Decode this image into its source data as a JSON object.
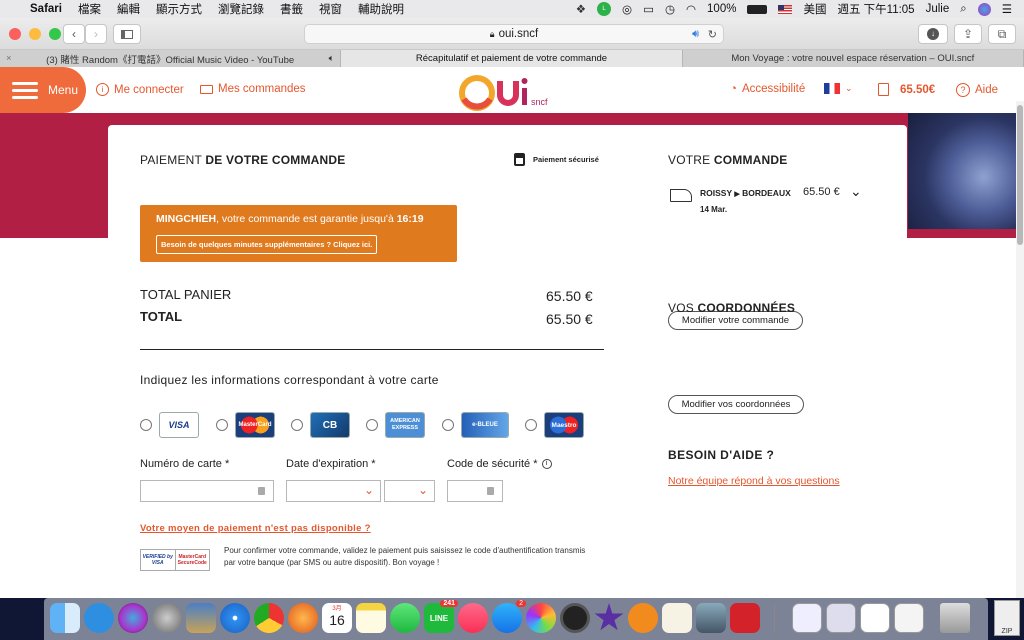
{
  "menubar": {
    "app": "Safari",
    "items": [
      "檔案",
      "編輯",
      "顯示方式",
      "瀏覽記錄",
      "書籤",
      "視窗",
      "輔助說明"
    ],
    "battery": "100%",
    "input_source": "美國",
    "datetime": "週五 下午11:05",
    "user": "Julie"
  },
  "toolbar": {
    "url": "oui.sncf"
  },
  "tabs": [
    {
      "label": "(3) 賭性 Random《打電話》Official Music Video - YouTube"
    },
    {
      "label": "Récapitulatif et paiement de votre commande"
    },
    {
      "label": "Mon Voyage : votre nouvel espace réservation – OUI.sncf"
    }
  ],
  "header": {
    "menu_label": "Menu",
    "login_label": "Me connecter",
    "orders_label": "Mes commandes",
    "logo_main": "OUi",
    "logo_sub": "sncf",
    "accessibility_label": "Accessibilité",
    "cart_total": "65.50€",
    "help_label": "Aide"
  },
  "payment": {
    "title_light": "PAIEMENT ",
    "title_bold": "DE VOTRE COMMANDE",
    "secure_label": "Paiement sécurisé",
    "timer_name": "MINGCHIEH",
    "timer_text": ", votre commande est garantie jusqu'à ",
    "timer_time": "16:19",
    "timer_button": "Besoin de quelques minutes supplémentaires ? Cliquez ici.",
    "total_panier_label": "TOTAL PANIER",
    "total_panier_value": "65.50 €",
    "total_label": "TOTAL",
    "total_value": "65.50 €",
    "card_prompt": "Indiquez les informations correspondant à votre carte",
    "card_types": [
      "VISA",
      "MasterCard",
      "CB",
      "AMERICAN EXPRESS",
      "e-BLEUE",
      "Maestro"
    ],
    "card_number_label": "Numéro de carte *",
    "expiry_label": "Date d'expiration *",
    "cvv_label": "Code de sécurité *",
    "unavailable_link": "Votre moyen de paiement n'est pas disponible ?",
    "secure3d_logo_left": "VERIFIED by VISA",
    "secure3d_logo_right": "MasterCard SecureCode",
    "confirm_text": "Pour confirmer votre commande, validez le paiement puis saisissez le code d'authentification transmis par votre banque (par SMS ou autre dispositif). Bon voyage !"
  },
  "summary": {
    "title_light": "VOTRE ",
    "title_bold": "COMMANDE",
    "route_from": "ROISSY",
    "route_to": "BORDEAUX",
    "price": "65.50 €",
    "date": "14 Mar.",
    "modify_order_button": "Modifier votre commande",
    "coords_title_light": "VOS ",
    "coords_title_bold": "COORDONNÉES",
    "modify_coords_button": "Modifier vos coordonnées",
    "help_title": "BESOIN D'AIDE ?",
    "help_link": "Notre équipe répond à vos questions"
  },
  "dock": {
    "calendar_month": "3月",
    "calendar_day": "16",
    "line_badge": "241",
    "appstore_badge": "2",
    "zip_label": "ZIP"
  },
  "colors": {
    "brand_orange": "#ef6b3b",
    "hero_red": "#b21f45",
    "timer_orange": "#e07a1f"
  }
}
